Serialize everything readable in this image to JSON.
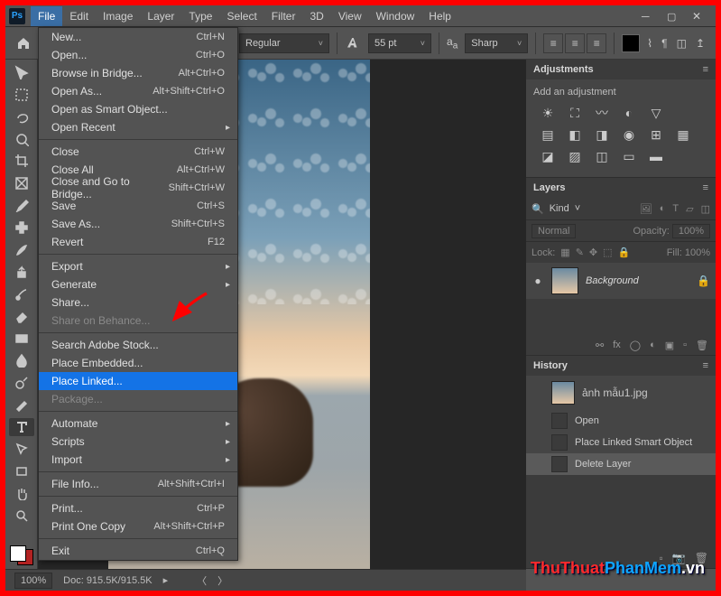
{
  "menubar": {
    "app_logo": "Ps",
    "items": [
      "File",
      "Edit",
      "Image",
      "Layer",
      "Type",
      "Select",
      "Filter",
      "3D",
      "View",
      "Window",
      "Help"
    ],
    "active_index": 0
  },
  "file_menu": {
    "items": [
      {
        "label": "New...",
        "shortcut": "Ctrl+N"
      },
      {
        "label": "Open...",
        "shortcut": "Ctrl+O"
      },
      {
        "label": "Browse in Bridge...",
        "shortcut": "Alt+Ctrl+O"
      },
      {
        "label": "Open As...",
        "shortcut": "Alt+Shift+Ctrl+O"
      },
      {
        "label": "Open as Smart Object..."
      },
      {
        "label": "Open Recent",
        "submenu": true
      },
      {
        "sep": true
      },
      {
        "label": "Close",
        "shortcut": "Ctrl+W"
      },
      {
        "label": "Close All",
        "shortcut": "Alt+Ctrl+W"
      },
      {
        "label": "Close and Go to Bridge...",
        "shortcut": "Shift+Ctrl+W"
      },
      {
        "label": "Save",
        "shortcut": "Ctrl+S"
      },
      {
        "label": "Save As...",
        "shortcut": "Shift+Ctrl+S"
      },
      {
        "label": "Revert",
        "shortcut": "F12"
      },
      {
        "sep": true
      },
      {
        "label": "Export",
        "submenu": true
      },
      {
        "label": "Generate",
        "submenu": true
      },
      {
        "label": "Share..."
      },
      {
        "label": "Share on Behance...",
        "disabled": true
      },
      {
        "sep": true
      },
      {
        "label": "Search Adobe Stock..."
      },
      {
        "label": "Place Embedded..."
      },
      {
        "label": "Place Linked...",
        "highlight": true
      },
      {
        "label": "Package...",
        "disabled": true
      },
      {
        "sep": true
      },
      {
        "label": "Automate",
        "submenu": true
      },
      {
        "label": "Scripts",
        "submenu": true
      },
      {
        "label": "Import",
        "submenu": true
      },
      {
        "sep": true
      },
      {
        "label": "File Info...",
        "shortcut": "Alt+Shift+Ctrl+I"
      },
      {
        "sep": true
      },
      {
        "label": "Print...",
        "shortcut": "Ctrl+P"
      },
      {
        "label": "Print One Copy",
        "shortcut": "Alt+Shift+Ctrl+P"
      },
      {
        "sep": true
      },
      {
        "label": "Exit",
        "shortcut": "Ctrl+Q"
      }
    ]
  },
  "options_bar": {
    "style_label": "Regular",
    "font_size": "55 pt",
    "aa_mode": "Sharp"
  },
  "tools_list": [
    "move",
    "marquee",
    "lasso",
    "quick-select",
    "crop",
    "frame",
    "eyedropper",
    "heal",
    "brush",
    "clone",
    "history-brush",
    "eraser",
    "gradient",
    "blur",
    "dodge",
    "pen",
    "type",
    "path-select",
    "rectangle",
    "hand",
    "zoom"
  ],
  "active_tool": "type",
  "panels": {
    "adjustments": {
      "title": "Adjustments",
      "subtitle": "Add an adjustment"
    },
    "layers": {
      "title": "Layers",
      "kind_search": "Kind",
      "blend_mode": "Normal",
      "opacity_label": "Opacity:",
      "opacity_value": "100%",
      "lock_label": "Lock:",
      "fill_label": "Fill:",
      "fill_value": "100%",
      "items": [
        {
          "name": "Background",
          "locked": true
        }
      ],
      "footer_icons": [
        "link",
        "fx",
        "mask",
        "adj",
        "group",
        "new",
        "trash"
      ]
    },
    "history": {
      "title": "History",
      "document": "ảnh mẫu1.jpg",
      "steps": [
        "Open",
        "Place Linked Smart Object",
        "Delete Layer"
      ],
      "selected_index": 2
    }
  },
  "status_bar": {
    "zoom": "100%",
    "doc_info": "Doc: 915.5K/915.5K"
  },
  "watermark": {
    "part1": "ThuThuat",
    "part2": "PhanMem",
    "suffix": ".vn"
  }
}
